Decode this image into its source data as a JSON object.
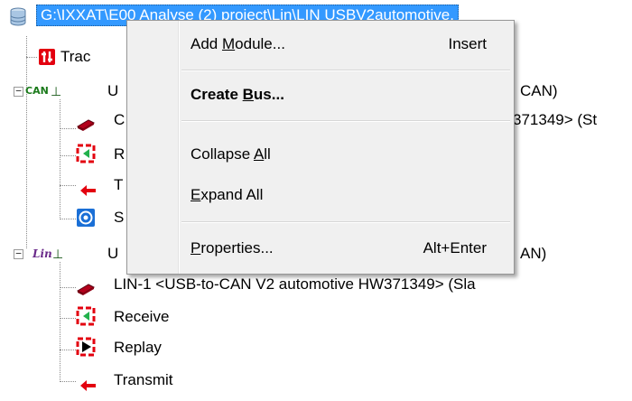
{
  "tree": {
    "root_label": "G:\\IXXAT\\E00  Analyse  (2)  project\\Lin\\LIN USBV2automotive.",
    "trace_label": "Trac",
    "can_group_label": "U",
    "can_group_tail": "CAN)",
    "can_items": [
      {
        "label": "C",
        "tail": "371349>  (St",
        "icon": "chip-icon"
      },
      {
        "label": "R",
        "icon": "receive-icon"
      },
      {
        "label": "T",
        "icon": "transmit-icon"
      },
      {
        "label": "S",
        "icon": "scheduler-icon"
      }
    ],
    "lin_group_label": "U",
    "lin_group_tail": "AN)",
    "lin_items": [
      {
        "label": "LIN-1  <USB-to-CAN V2 automotive  HW371349>  (Sla",
        "icon": "chip-icon"
      },
      {
        "label": "Receive",
        "icon": "receive-icon"
      },
      {
        "label": "Replay",
        "icon": "replay-icon"
      },
      {
        "label": "Transmit",
        "icon": "transmit-icon"
      }
    ]
  },
  "context_menu": {
    "add_module": {
      "pre": "Add ",
      "ul": "M",
      "post": "odule...",
      "shortcut": "Insert"
    },
    "create_bus": {
      "pre": "Create ",
      "ul": "B",
      "post": "us..."
    },
    "collapse_all": {
      "pre": "Collapse ",
      "ul": "A",
      "post": "ll"
    },
    "expand_all": {
      "pre": "",
      "ul": "E",
      "post": "xpand All"
    },
    "properties": {
      "pre": "",
      "ul": "P",
      "post": "roperties...",
      "shortcut": "Alt+Enter"
    }
  },
  "colors": {
    "selection": "#3399ff",
    "menu_bg": "#f0f0f0",
    "icon_red": "#e3000f",
    "icon_green": "#22b14c",
    "icon_blue": "#1a6fd6"
  }
}
